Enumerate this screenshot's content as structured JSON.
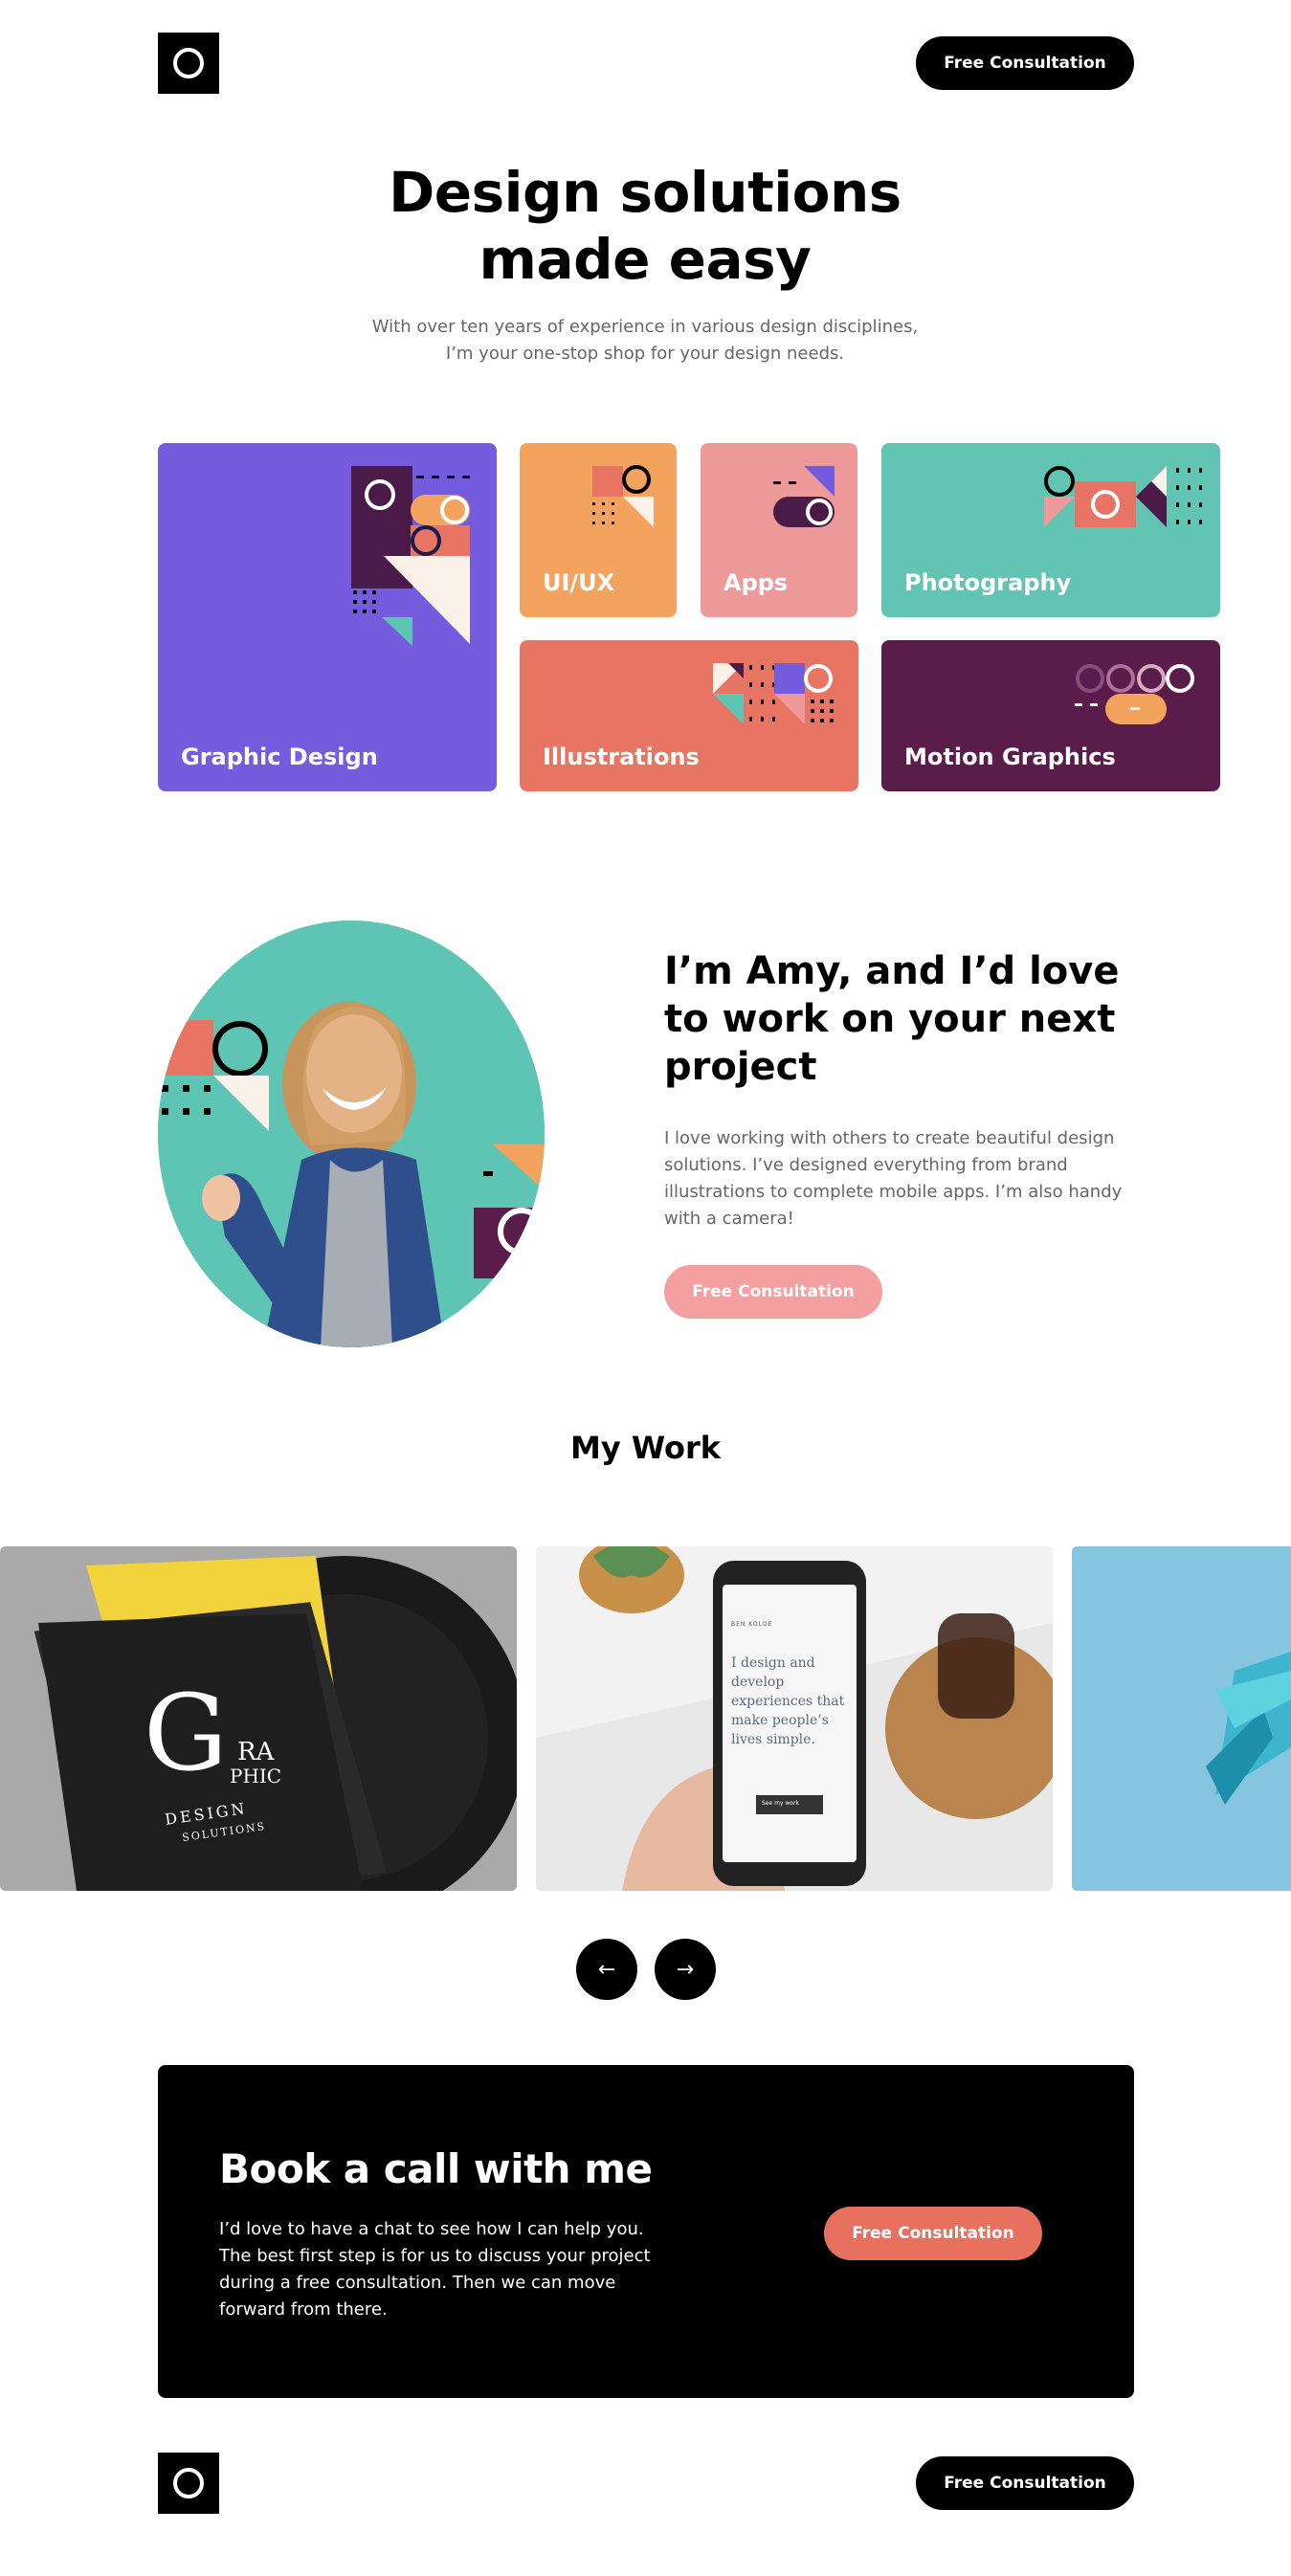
{
  "header": {
    "cta_label": "Free Consultation"
  },
  "hero": {
    "title": "Design solutions made easy",
    "subtitle": "With over ten years of experience in various design disciplines, I’m your one-stop shop for your design needs."
  },
  "services": [
    {
      "label": "Graphic Design",
      "color": "#755cde"
    },
    {
      "label": "UI/UX",
      "color": "#f4a35f"
    },
    {
      "label": "Apps",
      "color": "#ef9a9a"
    },
    {
      "label": "Photography",
      "color": "#62c4b3"
    },
    {
      "label": "Illustrations",
      "color": "#e87463"
    },
    {
      "label": "Motion Graphics",
      "color": "#5a1c4b"
    }
  ],
  "about": {
    "title": "I’m Amy, and I’d love to work on your next project",
    "text": "I love working with others to create beautiful design solutions. I’ve designed everything from brand illustrations to complete mobile apps. I’m also handy with a camera!",
    "cta_label": "Free Consultation"
  },
  "work": {
    "title": "My Work",
    "slides": [
      "graphic-design-book",
      "phone-mockup",
      "abstract-blue"
    ],
    "phone_screen": {
      "brand": "BEN KOLDE",
      "headline": "I design and develop experiences that make people’s lives simple.",
      "button": "See my work"
    },
    "book": {
      "letter": "G",
      "word1": "RA",
      "word2": "PHIC",
      "subtitle": "DESIGN",
      "subtitle2": "SOLUTIONS"
    }
  },
  "carousel": {
    "prev_icon": "arrow-left-icon",
    "next_icon": "arrow-right-icon"
  },
  "cta": {
    "title": "Book a call with me",
    "text": "I’d love to have a chat to see how I can help you. The best first step is for us to discuss your project during a free consultation. Then we can move forward from there.",
    "button_label": "Free Consultation"
  },
  "footer": {
    "cta_label": "Free Consultation"
  }
}
